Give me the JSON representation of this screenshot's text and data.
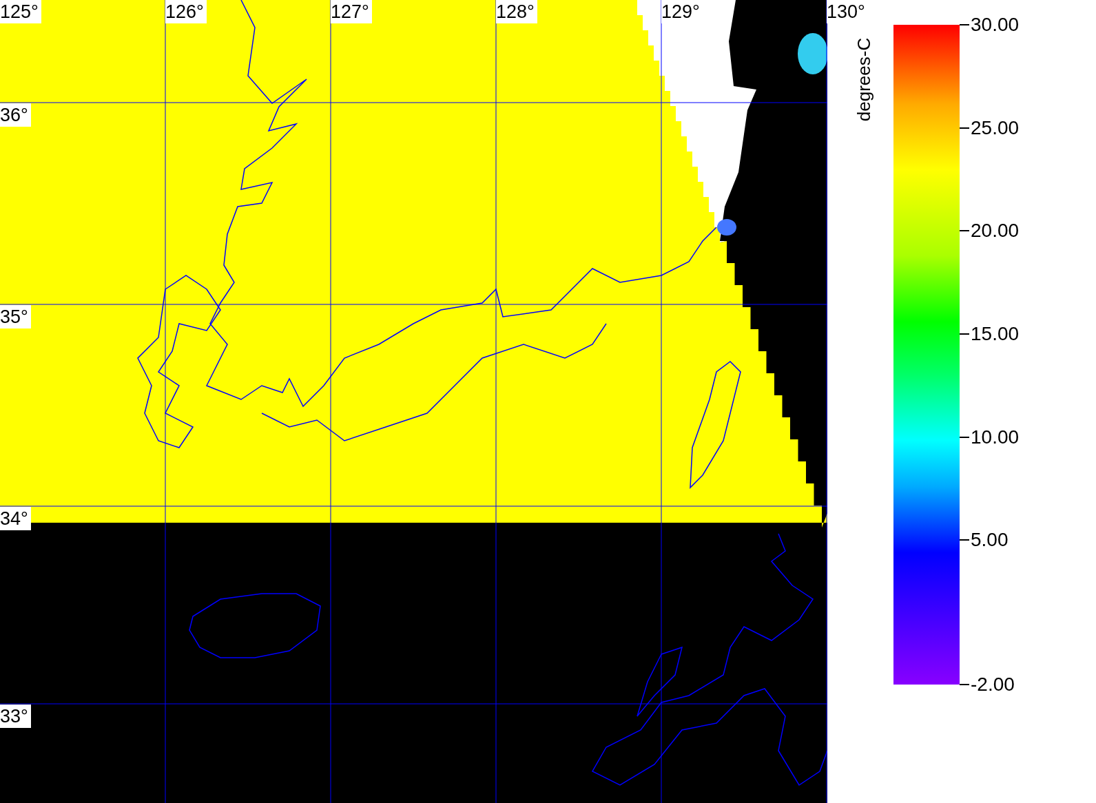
{
  "map": {
    "longitude_labels": [
      "125°",
      "126°",
      "127°",
      "128°",
      "129°",
      "130°"
    ],
    "latitude_labels": [
      "36°",
      "35°",
      "34°",
      "33°"
    ]
  },
  "colorbar": {
    "title": "degrees-C",
    "ticks": [
      "30.00",
      "25.00",
      "20.00",
      "15.00",
      "10.00",
      "5.00",
      "-2.00"
    ]
  }
}
